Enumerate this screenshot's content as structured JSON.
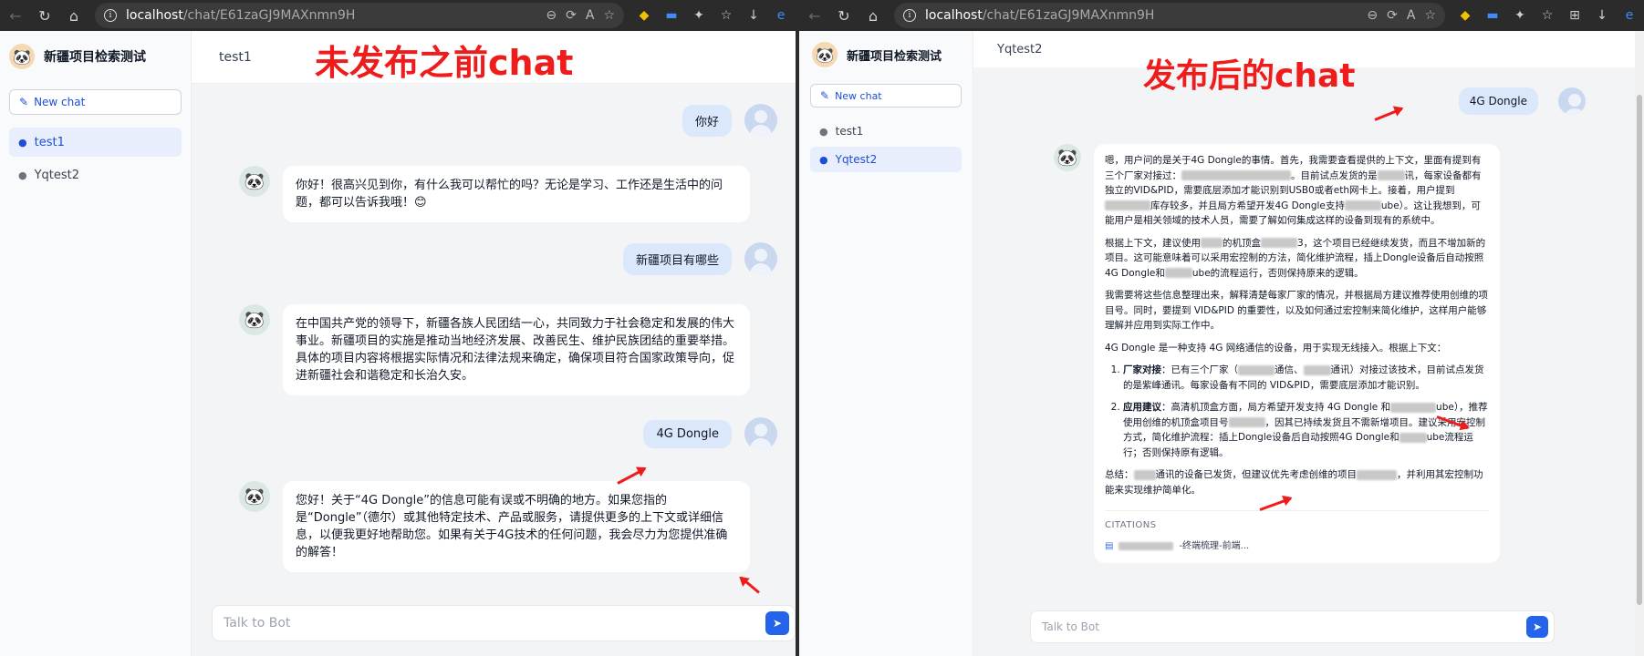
{
  "left": {
    "url_host": "localhost",
    "url_path": "/chat/E61zaGJ9MAXnmn9H",
    "brand": "新疆项目检索测试",
    "new_chat": "New chat",
    "chats": [
      "test1",
      "Yqtest2"
    ],
    "header_title": "test1",
    "annotation": "未发布之前chat",
    "messages": {
      "u1": "你好",
      "b1": "你好！很高兴见到你，有什么我可以帮忙的吗？无论是学习、工作还是生活中的问题，都可以告诉我哦！😊",
      "u2": "新疆项目有哪些",
      "b2": "在中国共产党的领导下，新疆各族人民团结一心，共同致力于社会稳定和发展的伟大事业。新疆项目的实施是推动当地经济发展、改善民生、维护民族团结的重要举措。具体的项目内容将根据实际情况和法律法规来确定，确保项目符合国家政策导向，促进新疆社会和谐稳定和长治久安。",
      "u3": "4G Dongle",
      "b3": "您好！关于“4G Dongle”的信息可能有误或不明确的地方。如果您指的是“Dongle”（德尔）或其他特定技术、产品或服务，请提供更多的上下文或详细信息，以便我更好地帮助您。如果有关于4G技术的任何问题，我会尽力为您提供准确的解答！"
    },
    "placeholder": "Talk to Bot"
  },
  "right": {
    "url_host": "localhost",
    "url_path": "/chat/E61zaGJ9MAXnmn9H",
    "brand": "新疆项目检索测试",
    "new_chat": "New chat",
    "chats": [
      "test1",
      "Yqtest2"
    ],
    "header_title": "Yqtest2",
    "annotation": "发布后的chat",
    "user_msg": "4G Dongle",
    "answer": {
      "p1a": "嗯，用户问的是关于4G Dongle的事情。首先，我需要查看提供的上下文，里面有提到有三个厂家对接过：",
      "p1b": "。目前试点发货的是",
      "p1c": "讯，每家设备都有独立的VID&PID，需要底层添加才能识别到USB0或者eth网卡上。接着，用户提到",
      "p1d": "库存较多，并且局方希望开发4G Dongle支持",
      "p1e": "ube）。这让我想到，可能用户是相关领域的技术人员，需要了解如何集成这样的设备到现有的系统中。",
      "p2a": "根据上下文，建议使用",
      "p2b": "的机顶盒",
      "p2c": "3，这个项目已经继续发货，而且不增加新的项目。这可能意味着可以采用宏控制的方法，简化维护流程，插上Dongle设备后自动按照4G Dongle和",
      "p2d": "ube的流程运行，否则保持原来的逻辑。",
      "p3": "我需要将这些信息整理出来，解释清楚每家厂家的情况，并根据局方建议推荐使用创维的项目号。同时，要提到 VID&PID 的重要性，以及如何通过宏控制来简化维护，这样用户能够理解并应用到实际工作中。",
      "p4": "4G Dongle 是一种支持 4G 网络通信的设备，用于实现无线接入。根据上下文：",
      "li1_title": "厂家对接",
      "li1a": "：已有三个厂家（",
      "li1b": "通信、",
      "li1c": "通讯）对接过该技术，目前试点发货的是紫峰通讯。每家设备有不同的 VID&PID，需要底层添加才能识别。",
      "li2_title": "应用建议",
      "li2a": "：高清机顶盒方面，局方希望开发支持 4G Dongle 和",
      "li2b": "ube），推荐使用创维的机顶盒项目号",
      "li2c": "，因其已持续发货且不需新增项目。建议采用宏控制方式，简化维护流程：插上Dongle设备后自动按照4G Dongle和",
      "li2d": "ube流程运行；否则保持原有逻辑。",
      "sum_a": "总结：",
      "sum_b": "通讯的设备已发货，但建议优先考虑创维的项目",
      "sum_c": "，并利用其宏控制功能来实现维护简单化。"
    },
    "citations_label": "CITATIONS",
    "citation_item": "-终端梳理-前端...",
    "placeholder": "Talk to Bot"
  }
}
